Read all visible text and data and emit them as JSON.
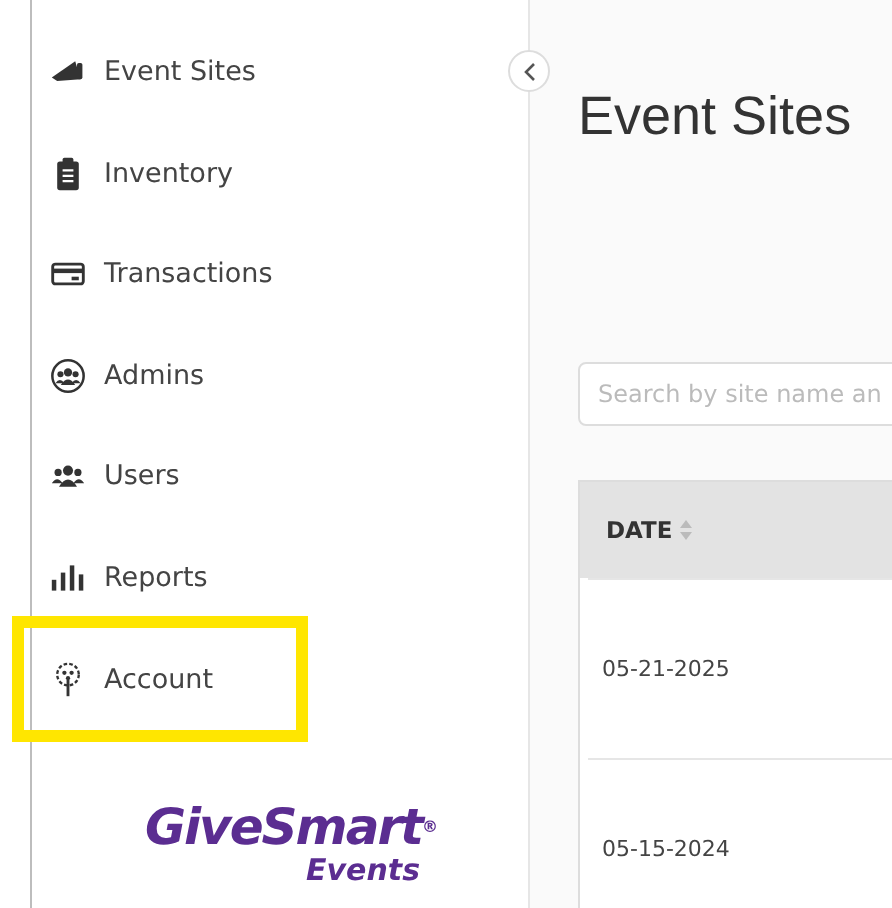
{
  "sidebar": {
    "items": [
      {
        "kind": "megaphone",
        "label": "Event Sites",
        "highlighted": false
      },
      {
        "kind": "clipboard",
        "label": "Inventory",
        "highlighted": false
      },
      {
        "kind": "card",
        "label": "Transactions",
        "highlighted": false
      },
      {
        "kind": "admins",
        "label": "Admins",
        "highlighted": false
      },
      {
        "kind": "users",
        "label": "Users",
        "highlighted": false
      },
      {
        "kind": "chart",
        "label": "Reports",
        "highlighted": false
      },
      {
        "kind": "tree",
        "label": "Account",
        "highlighted": true
      }
    ],
    "logo": {
      "name": "GiveSmart",
      "mark": "®",
      "sub": "Events"
    }
  },
  "page": {
    "title": "Event Sites",
    "search": {
      "placeholder": "Search by site name an"
    },
    "table": {
      "columns": [
        {
          "label": "DATE",
          "sortable": true
        }
      ],
      "rows": [
        {
          "date": "05-21-2025"
        },
        {
          "date": "05-15-2024"
        }
      ]
    }
  }
}
